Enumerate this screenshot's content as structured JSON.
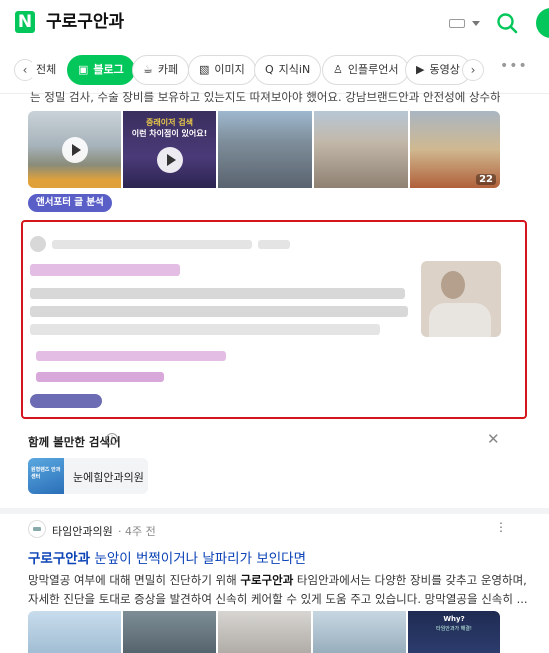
{
  "header": {
    "logo": "N",
    "query": "구로구안과"
  },
  "tabs": [
    {
      "label": "전체",
      "icon": "chevron-left-icon"
    },
    {
      "label": "블로그",
      "icon": "blog-icon"
    },
    {
      "label": "카페",
      "icon": "cafe-icon"
    },
    {
      "label": "이미지",
      "icon": "image-icon"
    },
    {
      "label": "지식iN",
      "icon": "kin-icon"
    },
    {
      "label": "인플루언서",
      "icon": "influencer-icon"
    },
    {
      "label": "동영상",
      "icon": "video-icon"
    }
  ],
  "top_result": {
    "snippet": "는 정밀 검사, 수술 장비를 보유하고 있는지도 따져보아야 했어요. 강남브랜드안과 안전성에 상수하는 ...",
    "images": [
      {
        "icon": "play-icon"
      },
      {
        "icon": "play-icon",
        "ad_line1": "중래이저 검색",
        "ad_line2": "이런 차이점이 있어요!"
      },
      {},
      {},
      {
        "count": "22"
      }
    ],
    "analysis_label": "앤서포터 글 분석"
  },
  "related": {
    "title": "함께 볼만한 검색어",
    "info": "i",
    "close": "✕",
    "items": [
      {
        "label": "눈에힘안과의원",
        "thumb_text": "원형렌즈 안과 센터"
      }
    ]
  },
  "result2": {
    "source": "타임안과의원",
    "time": "· 4주 전",
    "menu": "⋮",
    "title_bold": "구로구안과",
    "title_rest": " 눈앞이 번쩍이거나 날파리가 보인다면",
    "desc_line1_a": "망막열공 여부에 대해 면밀히 진단하기 위해 ",
    "desc_line1_bold": "구로구안과",
    "desc_line1_b": " 타임안과에서는 다양한 장비를 갖추고 운영하며,",
    "desc_line2": "자세한 진단을 토대로 증상을 발견하여 신속히 케어할 수 있게 도움 주고 있습니다. 망막열공을 신속히 ...",
    "image_why": "Why?",
    "image_why_sub": "타임안과가 해결!"
  },
  "colors": {
    "naver_green": "#03c75a",
    "highlight_red": "#d4161c",
    "link_blue": "#0c43b7",
    "analysis_purple": "#5a5fc8"
  }
}
